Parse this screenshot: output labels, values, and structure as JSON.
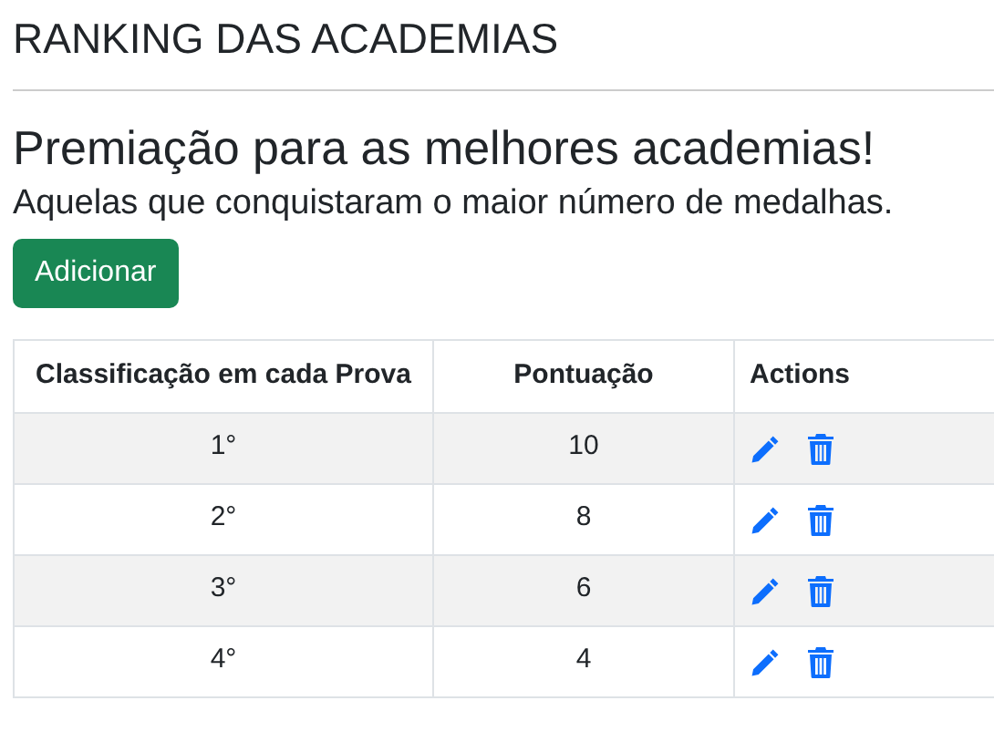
{
  "page_title": "RANKING DAS ACADEMIAS",
  "heading": "Premiação para as melhores academias!",
  "subtitle": "Aquelas que conquistaram o maior número de medalhas.",
  "add_button": "Adicionar",
  "table": {
    "columns": [
      "Classificação em cada Prova",
      "Pontuação",
      "Actions"
    ],
    "rows": [
      {
        "place": "1°",
        "points": "10"
      },
      {
        "place": "2°",
        "points": "8"
      },
      {
        "place": "3°",
        "points": "6"
      },
      {
        "place": "4°",
        "points": "4"
      }
    ]
  }
}
